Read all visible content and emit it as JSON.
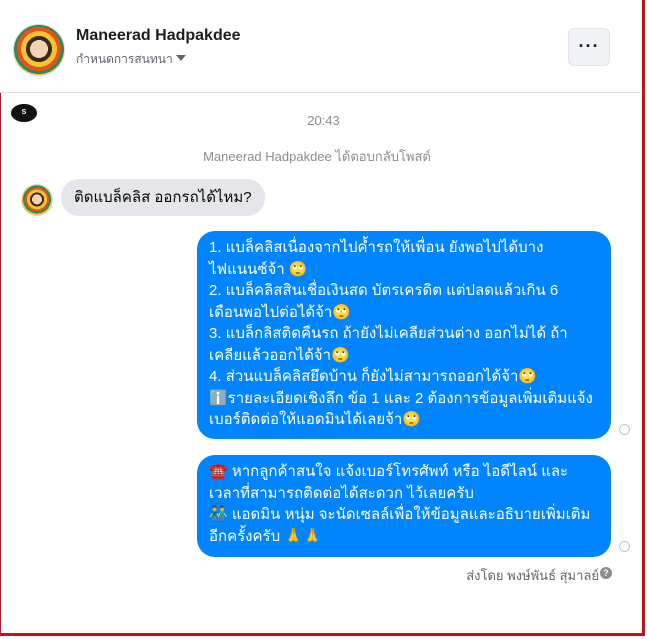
{
  "header": {
    "contact_name": "Maneerad Hadpakdee",
    "subtitle": "กำหนดการสนทนา",
    "more_label": "···"
  },
  "page_icon_label": "S",
  "thread": {
    "timestamp": "20:43",
    "notice": "Maneerad Hadpakdee ได้ตอบกลับโพสต์",
    "incoming": "ติดแบล็คลิส ออกรถได้ไหม?",
    "outgoing_1": [
      "1. แบล็คลิสเนื่องจากไปค้ำรถให้เพื่อน ยังพอไปได้บาง",
      "ไฟแนนซ์จ้า 🙄",
      "2. แบล็คลิสสินเชื่อเงินสด บัตรเครดิต แต่ปลดแล้วเกิน 6",
      "เดือนพอไปต่อได้จ้า🙄",
      "3. แบล็กลิสติดคืนรถ ถ้ายังไม่เคลียส่วนต่าง ออกไม่ได้ ถ้า",
      "เคลียแล้วออกได้จ้า🙄",
      "4. ส่วนแบล็คลิสยึดบ้าน ก็ยังไม่สามารถออกได้จ้า🙄",
      "ℹ️รายละเอียดเชิงลึก ข้อ 1 และ 2 ต้องการข้อมูลเพิ่มเติมแจ้ง",
      "เบอร์ติดต่อให้แอดมินได้เลยจ้า🙄"
    ],
    "outgoing_2": [
      "☎️ หากลูกค้าสนใจ แจ้งเบอร์โทรศัพท์ หรือ ไอดีไลน์ และ",
      "เวลาที่สามารถติดต่อได้สะดวก ไว้เลยครับ",
      "👬 แอดมิน หนุ่ม จะนัดเซลล์เพื่อให้ข้อมูลและอธิบายเพิ่มเติม",
      "อีกครั้งครับ 🙏🙏"
    ],
    "sent_by": "ส่งโดย พงษ์พันธ์ สุมาลย์",
    "help_label": "?"
  }
}
